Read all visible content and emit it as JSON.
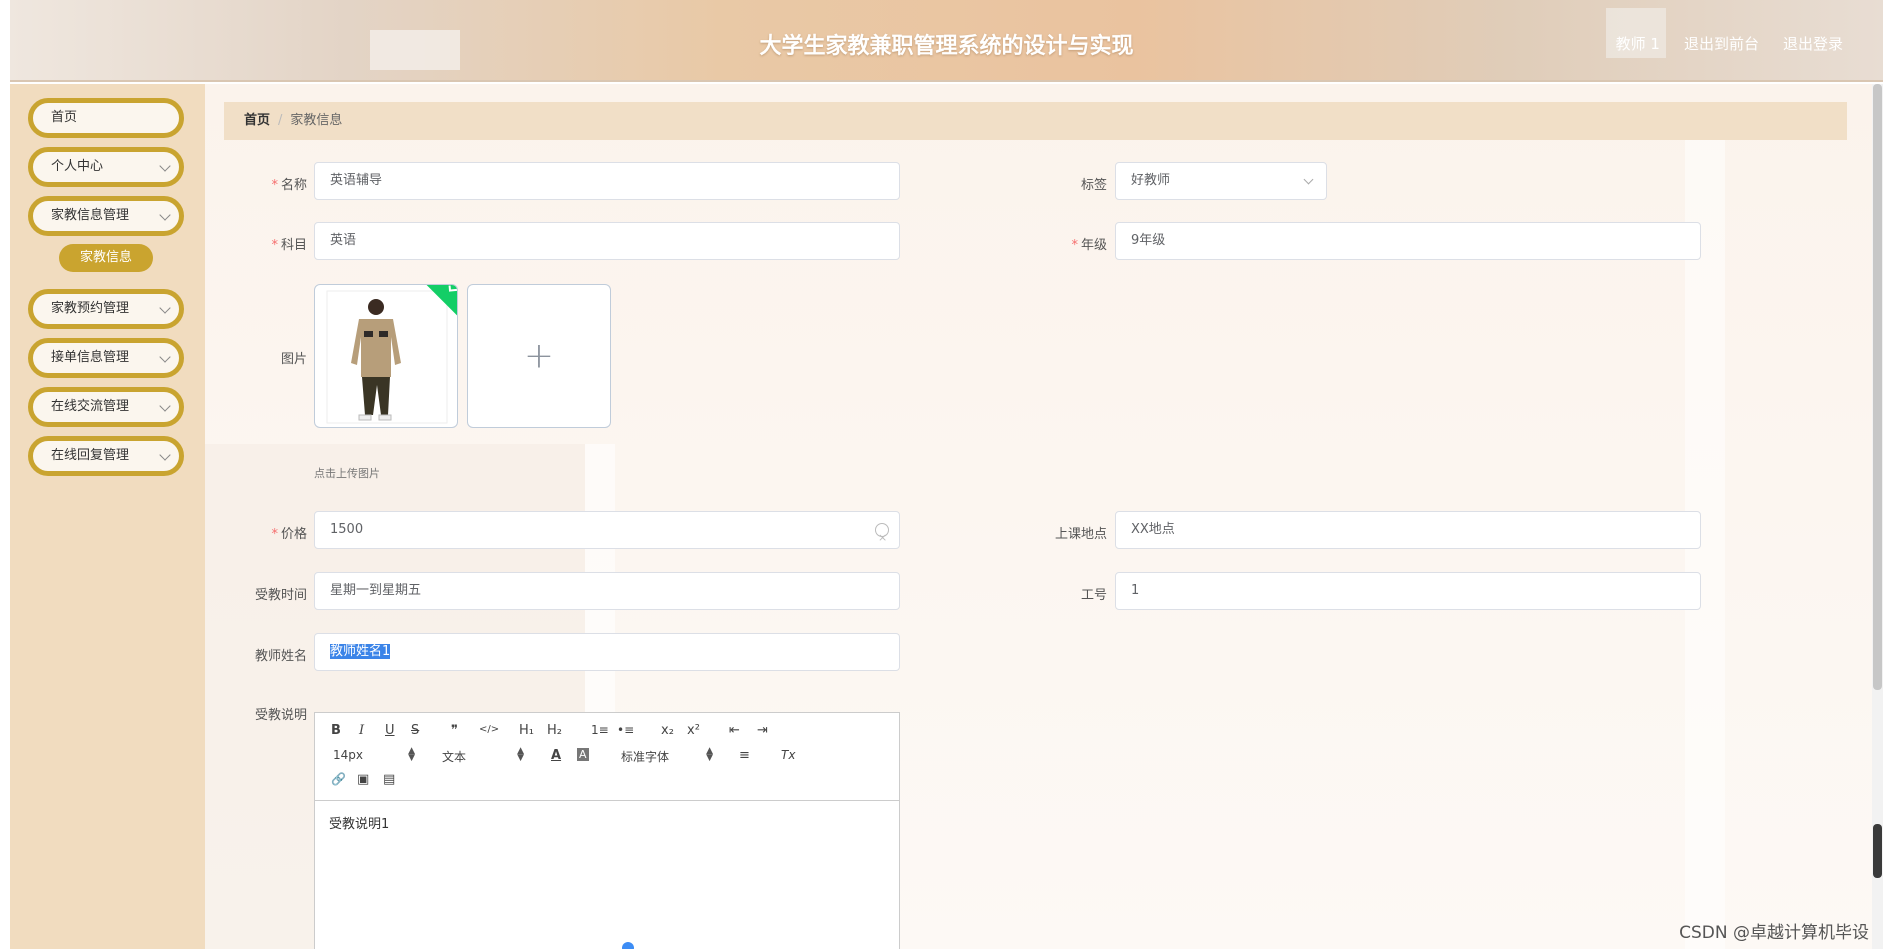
{
  "header": {
    "title": "大学生家教兼职管理系统的设计与实现",
    "nav": [
      "教师 1",
      "退出到前台",
      "退出登录"
    ]
  },
  "sidebar": {
    "items": [
      {
        "label": "首页",
        "chevron": false
      },
      {
        "label": "个人中心",
        "chevron": true
      },
      {
        "label": "家教信息管理",
        "chevron": true
      },
      {
        "label": "家教预约管理",
        "chevron": true
      },
      {
        "label": "接单信息管理",
        "chevron": true
      },
      {
        "label": "在线交流管理",
        "chevron": true
      },
      {
        "label": "在线回复管理",
        "chevron": true
      }
    ],
    "sub_active": "家教信息"
  },
  "breadcrumb": {
    "home": "首页",
    "separator": "/",
    "current": "家教信息"
  },
  "form": {
    "name": {
      "label": "名称",
      "value": "英语辅导",
      "required": true
    },
    "tag": {
      "label": "标签",
      "value": "好教师"
    },
    "subject": {
      "label": "科目",
      "value": "英语",
      "required": true
    },
    "grade": {
      "label": "年级",
      "value": "9年级",
      "required": true
    },
    "image": {
      "label": "图片",
      "tip": "点击上传图片"
    },
    "price": {
      "label": "价格",
      "value": "1500",
      "required": true
    },
    "location": {
      "label": "上课地点",
      "value": "XX地点"
    },
    "time": {
      "label": "受教时间",
      "value": "星期一到星期五"
    },
    "job_no": {
      "label": "工号",
      "value": "1"
    },
    "teacher": {
      "label": "教师姓名",
      "value": "教师姓名1"
    },
    "desc": {
      "label": "受教说明",
      "value": "受教说明1"
    }
  },
  "editor_toolbar": {
    "bold": "B",
    "italic": "I",
    "underline": "U",
    "strike": "S",
    "quote": "❞",
    "code": "</>",
    "h1": "H₁",
    "h2": "H₂",
    "ol": "1≡",
    "ul": "•≡",
    "sub": "x₂",
    "sup": "x²",
    "outdent": "⇤",
    "indent": "⇥",
    "size": "14px",
    "format": "文本",
    "font": "标准字体",
    "color": "A",
    "bg": "A",
    "align": "≡",
    "clean": "Tx",
    "link": "🔗",
    "image": "▣",
    "video": "▤"
  },
  "watermark": "CSDN @卓越计算机毕设",
  "colors": {
    "accent": "#c9a430",
    "sidebar": "#f1dcbf",
    "required": "#f56c6c",
    "success": "#13ce66"
  }
}
